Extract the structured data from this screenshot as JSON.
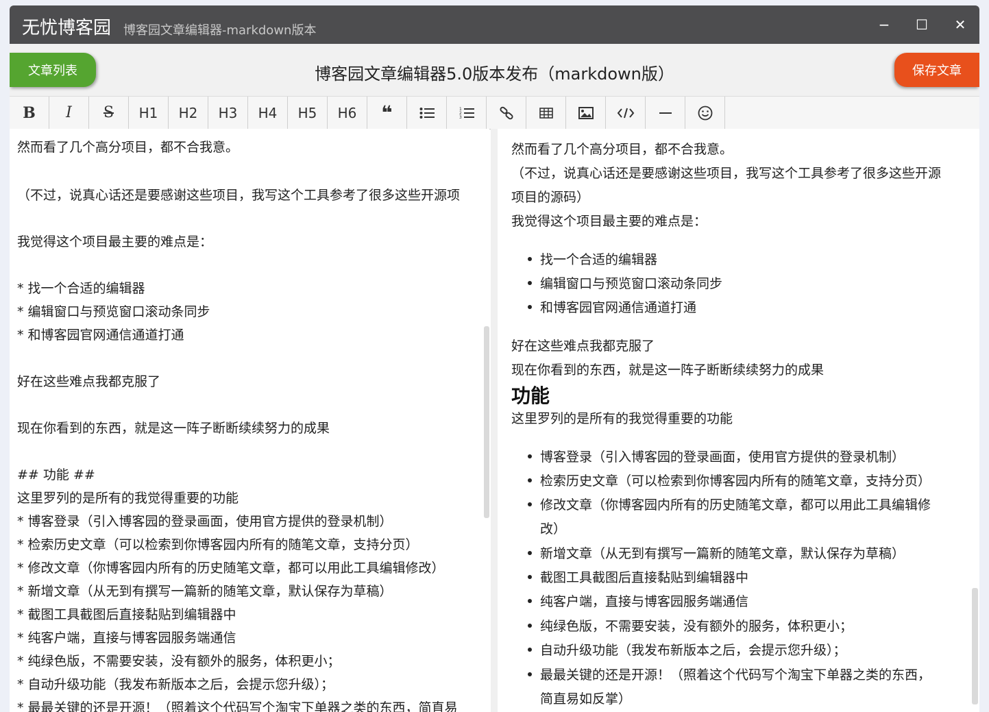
{
  "window": {
    "app_name": "无忧博客园",
    "app_subtitle": "博客园文章编辑器-markdown版本",
    "minimize": "−",
    "maximize": "☐",
    "close": "✕"
  },
  "header": {
    "list_button": "文章列表",
    "title": "博客园文章编辑器5.0版本发布（markdown版）",
    "save_button": "保存文章"
  },
  "toolbar": {
    "bold": "B",
    "italic": "I",
    "strike": "S",
    "h1": "H1",
    "h2": "H2",
    "h3": "H3",
    "h4": "H4",
    "h5": "H5",
    "h6": "H6",
    "quote": "❝",
    "icons": [
      "bold-icon",
      "italic-icon",
      "strikethrough-icon",
      "h1",
      "h2",
      "h3",
      "h4",
      "h5",
      "h6",
      "quote-icon",
      "unordered-list-icon",
      "ordered-list-icon",
      "link-icon",
      "table-icon",
      "image-icon",
      "code-icon",
      "horizontal-rule-icon",
      "emoji-icon"
    ]
  },
  "editor": {
    "lines": [
      "然而看了几个高分项目，都不合我意。",
      "（不过，说真心话还是要感谢这些项目，我写这个工具参考了很多这些开源项",
      "我觉得这个项目最主要的难点是：",
      "* 找一个合适的编辑器",
      "* 编辑窗口与预览窗口滚动条同步",
      "* 和博客园官网通信通道打通",
      "好在这些难点我都克服了",
      "现在你看到的东西，就是这一阵子断断续续努力的成果",
      "## 功能 ##",
      "这里罗列的是所有的我觉得重要的功能",
      "* 博客登录（引入博客园的登录画面，使用官方提供的登录机制）",
      "* 检索历史文章（可以检索到你博客园内所有的随笔文章，支持分页）",
      "* 修改文章（你博客园内所有的历史随笔文章，都可以用此工具编辑修改）",
      "* 新增文章（从无到有撰写一篇新的随笔文章，默认保存为草稿）",
      "* 截图工具截图后直接黏贴到编辑器中",
      "* 纯客户端，直接与博客园服务端通信",
      "* 纯绿色版，不需要安装，没有额外的服务，体积更小；",
      "* 自动升级功能（我发布新版本之后，会提示您升级）；",
      "* 最最关键的还是开源！（照着这个代码写个淘宝下单器之类的东西，简直易"
    ]
  },
  "preview": {
    "p1": "然而看了几个高分项目，都不合我意。",
    "p2a": "（不过，说真心话还是要感谢这些项目，我写这个工具参考了很多这些开源",
    "p2b": "项目的源码）",
    "p3": "我觉得这个项目最主要的难点是：",
    "list1": [
      "找一个合适的编辑器",
      "编辑窗口与预览窗口滚动条同步",
      "和博客园官网通信通道打通"
    ],
    "p4": "好在这些难点我都克服了",
    "p5": "现在你看到的东西，就是这一阵子断断续续努力的成果",
    "h2": "功能",
    "p6": "这里罗列的是所有的我觉得重要的功能",
    "list2": [
      "博客登录（引入博客园的登录画面，使用官方提供的登录机制）",
      "检索历史文章（可以检索到你博客园内所有的随笔文章，支持分页）",
      "修改文章（你博客园内所有的历史随笔文章，都可以用此工具编辑修",
      "改）",
      "新增文章（从无到有撰写一篇新的随笔文章，默认保存为草稿）",
      "截图工具截图后直接黏贴到编辑器中",
      "纯客户端，直接与博客园服务端通信",
      "纯绿色版，不需要安装，没有额外的服务，体积更小；",
      "自动升级功能（我发布新版本之后，会提示您升级）；",
      "最最关键的还是开源！（照着这个代码写个淘宝下单器之类的东西，",
      "简直易如反掌）"
    ]
  }
}
